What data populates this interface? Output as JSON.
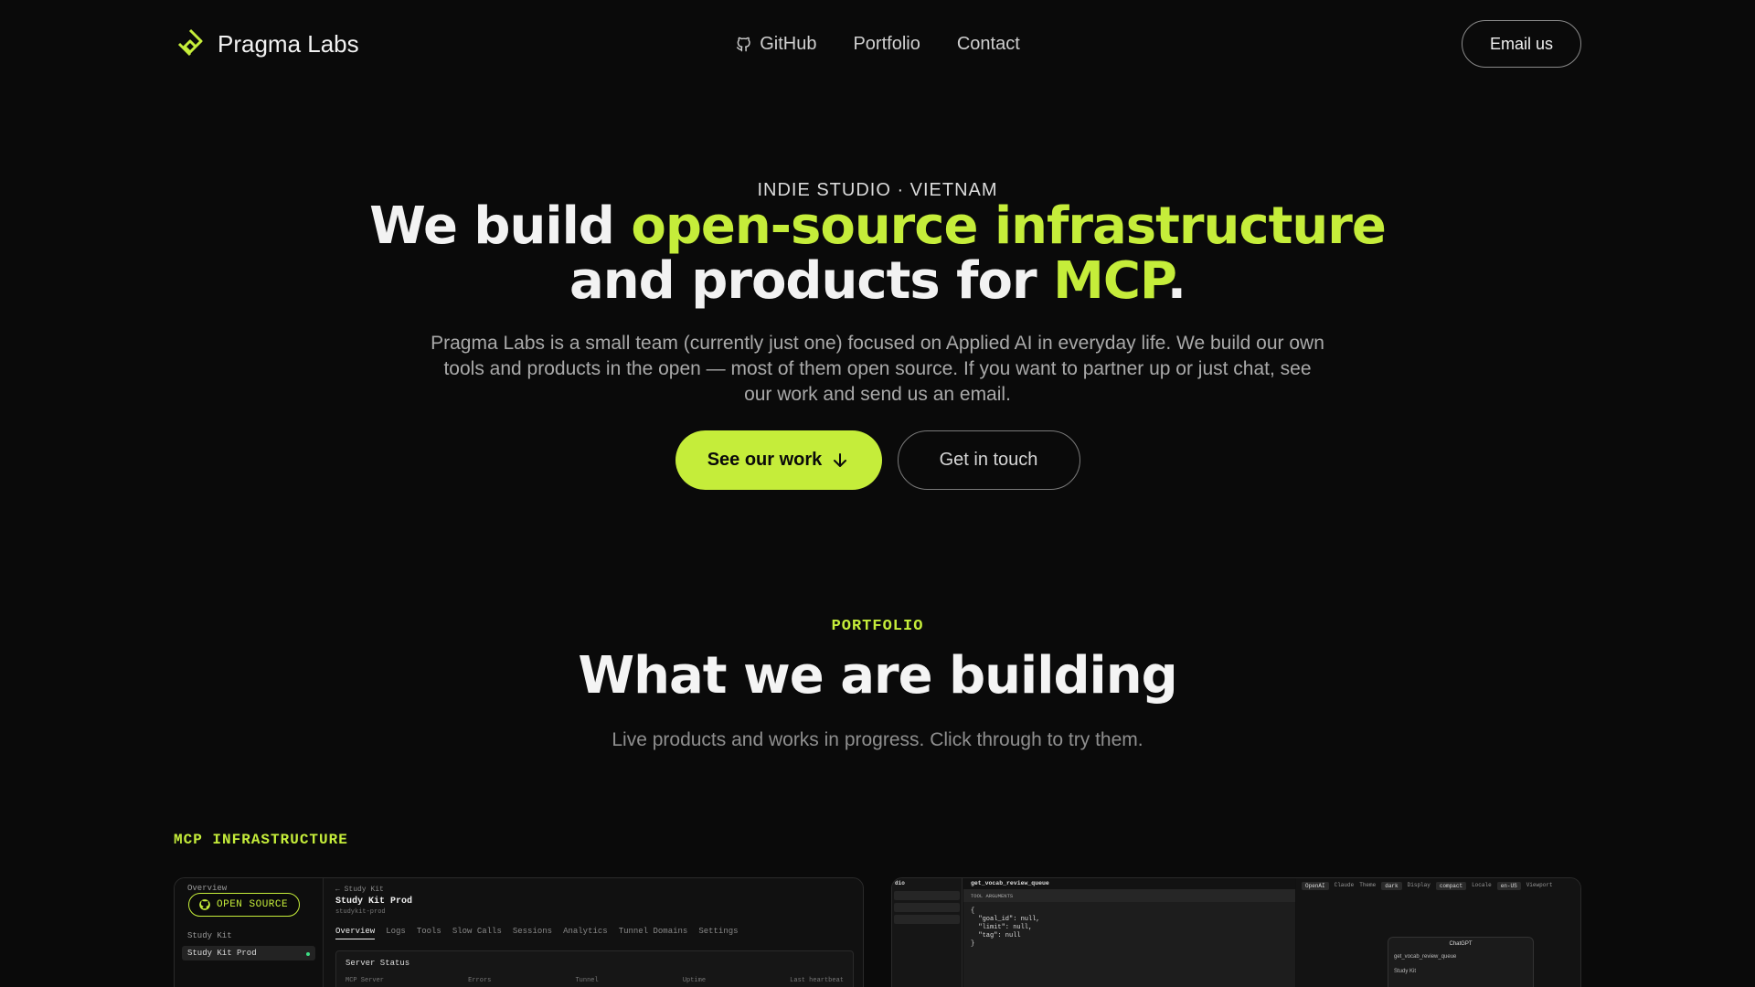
{
  "nav": {
    "brand": "Pragma Labs",
    "links": [
      {
        "label": "GitHub",
        "icon": "github-icon"
      },
      {
        "label": "Portfolio"
      },
      {
        "label": "Contact"
      }
    ],
    "cta": "Email us"
  },
  "hero": {
    "eyebrow": "INDIE STUDIO · VIETNAM",
    "title_part1": "We build ",
    "title_accent1": "open-source infrastructure",
    "title_part2": "and products for ",
    "title_accent2": "MCP",
    "title_end": ".",
    "subtitle": "Pragma Labs is a small team (currently just one) focused on Applied AI in everyday life. We build our own tools and products in the open — most of them open source. If you want to partner up or just chat, see our work and send us an email.",
    "primary_cta": "See our work",
    "secondary_cta": "Get in touch"
  },
  "portfolio": {
    "eyebrow": "PORTFOLIO",
    "title": "What we are building",
    "subtitle": "Live products and works in progress. Click through to try them.",
    "category": "MCP INFRASTRUCTURE",
    "card1": {
      "badge": "OPEN SOURCE",
      "side_rows": [
        "Overview",
        "Study Kit"
      ],
      "side_active": "Study Kit Prod",
      "crumb": "← Study Kit",
      "title": "Study Kit Prod",
      "slug": "studykit-prod",
      "tabs": [
        "Overview",
        "Logs",
        "Tools",
        "Slow Calls",
        "Sessions",
        "Analytics",
        "Tunnel Domains",
        "Settings"
      ],
      "panel_title": "Server Status",
      "panel_cols": [
        "MCP Server",
        "Errors",
        "Tunnel",
        "Uptime",
        "Last heartbeat"
      ]
    },
    "card2": {
      "left_title": "dio",
      "tool_title": "get_vocab_review_queue",
      "args_label": "TOOL ARGUMENTS",
      "code": "{\n  \"goal_id\": null,\n  \"limit\": null,\n  \"tag\": null\n}",
      "top_chips": [
        "OpenAI",
        "Claude",
        "Theme",
        "dark",
        "Display",
        "compact",
        "Locale",
        "en-US",
        "Viewport"
      ],
      "chat_title": "ChatGPT",
      "chat_item1": "get_vocab_review_queue",
      "chat_item2": "Study Kit"
    }
  },
  "colors": {
    "accent": "#c5ed3a",
    "background": "#0a0a0a"
  }
}
